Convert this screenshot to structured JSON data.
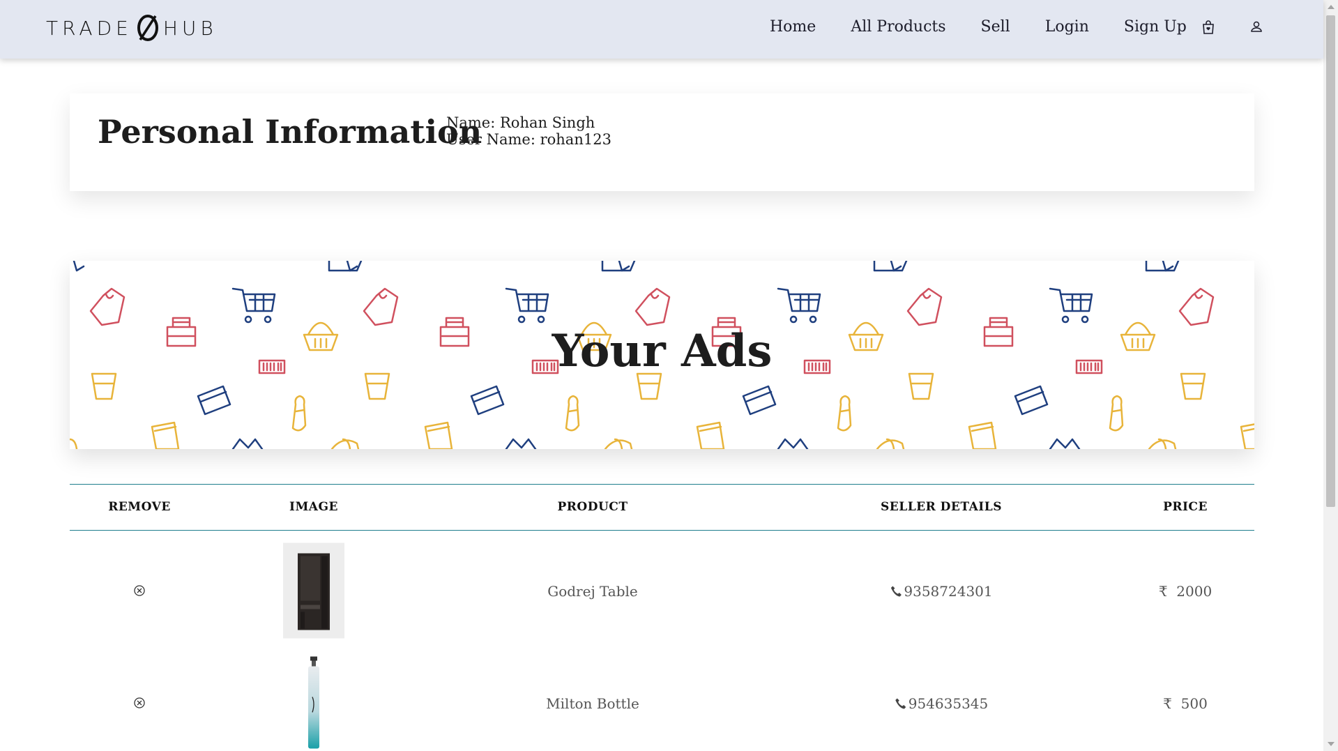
{
  "brand": {
    "left": "TRADE",
    "right": "HUB"
  },
  "nav": {
    "links": [
      "Home",
      "All Products",
      "Sell",
      "Login",
      "Sign Up"
    ],
    "icons": [
      "shopping-bag-icon",
      "user-icon"
    ]
  },
  "personal_info": {
    "title": "Personal Information",
    "name_line": "Name: Rohan Singh",
    "username_line": "User Name: rohan123"
  },
  "ads_banner": {
    "title": "Your Ads"
  },
  "table": {
    "headers": [
      "REMOVE",
      "IMAGE",
      "PRODUCT",
      "SELLER DETAILS",
      "PRICE"
    ],
    "rows": [
      {
        "product": "Godrej Table",
        "phone": "9358724301",
        "currency": "₹",
        "price": "2000",
        "image": "dark-wooden-table"
      },
      {
        "product": "Milton Bottle",
        "phone": "954635345",
        "currency": "₹",
        "price": "500",
        "image": "teal-steel-bottle"
      }
    ]
  },
  "colors": {
    "navbar_bg": "#e3e7f1",
    "table_rule": "#1e7d8c",
    "pattern_red": "#d0505e",
    "pattern_blue": "#1f3f7f",
    "pattern_yellow": "#e8b43a"
  }
}
